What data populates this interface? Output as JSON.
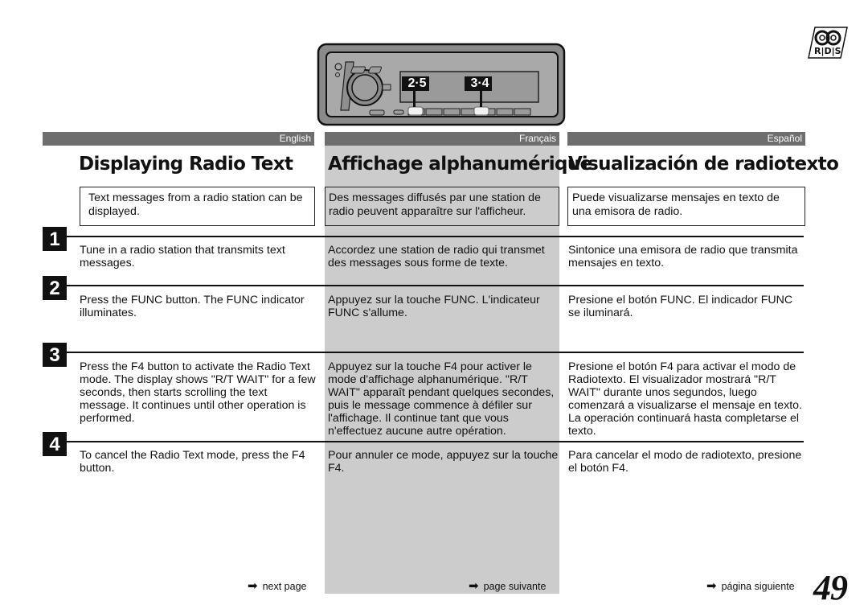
{
  "illustration": {
    "callout_left": "2·5",
    "callout_right": "3·4"
  },
  "logo": {
    "name": "RDS logo",
    "label": "RDS"
  },
  "columns": {
    "en": {
      "language": "English",
      "title": "Displaying Radio Text",
      "intro": "Text messages from a radio station can be displayed.",
      "steps": [
        "Tune in a radio station that transmits text messages.",
        "Press the FUNC button. The FUNC indicator illuminates.",
        "Press the F4 button to activate the Radio Text mode. The display shows \"R/T WAIT\" for a few seconds, then starts scrolling the text message. It continues until other operation is performed.",
        "To cancel the Radio Text mode, press the F4 button."
      ],
      "next": "next page"
    },
    "fr": {
      "language": "Français",
      "title": "Affichage alphanumérique",
      "intro": "Des messages diffusés par une station de radio peuvent apparaître sur l'afficheur.",
      "steps": [
        "Accordez une station de radio qui transmet des messages sous forme de texte.",
        "Appuyez sur la touche FUNC. L'indicateur FUNC s'allume.",
        "Appuyez sur la touche F4 pour activer le mode d'affichage alphanumérique. \"R/T WAIT\" apparaît pendant quelques secondes, puis le message commence à défiler sur l'affichage. Il continue tant que vous n'effectuez aucune autre opération.",
        "Pour annuler ce mode, appuyez sur la touche F4."
      ],
      "next": "page suivante"
    },
    "es": {
      "language": "Español",
      "title": "Visualización de radiotexto",
      "intro": "Puede visualizarse mensajes en texto de una emisora de radio.",
      "steps": [
        "Sintonice una emisora de radio que transmita mensajes en texto.",
        "Presione el botón FUNC. El indicador FUNC se iluminará.",
        "Presione el botón F4 para activar el modo de Radiotexto. El visualizador mostrará \"R/T WAIT\" durante unos segundos, luego comenzará a visualizarse el mensaje en texto. La operación continuará hasta completarse el texto.",
        "Para cancelar el modo de radiotexto, presione el botón F4."
      ],
      "next": "página siguiente"
    }
  },
  "step_numbers": [
    "1",
    "2",
    "3",
    "4"
  ],
  "next_arrow": "➡",
  "page_number": "49",
  "colors": {
    "lang_bar": "#6e6e6e",
    "french_column": "#cccccc",
    "text": "#111111"
  }
}
